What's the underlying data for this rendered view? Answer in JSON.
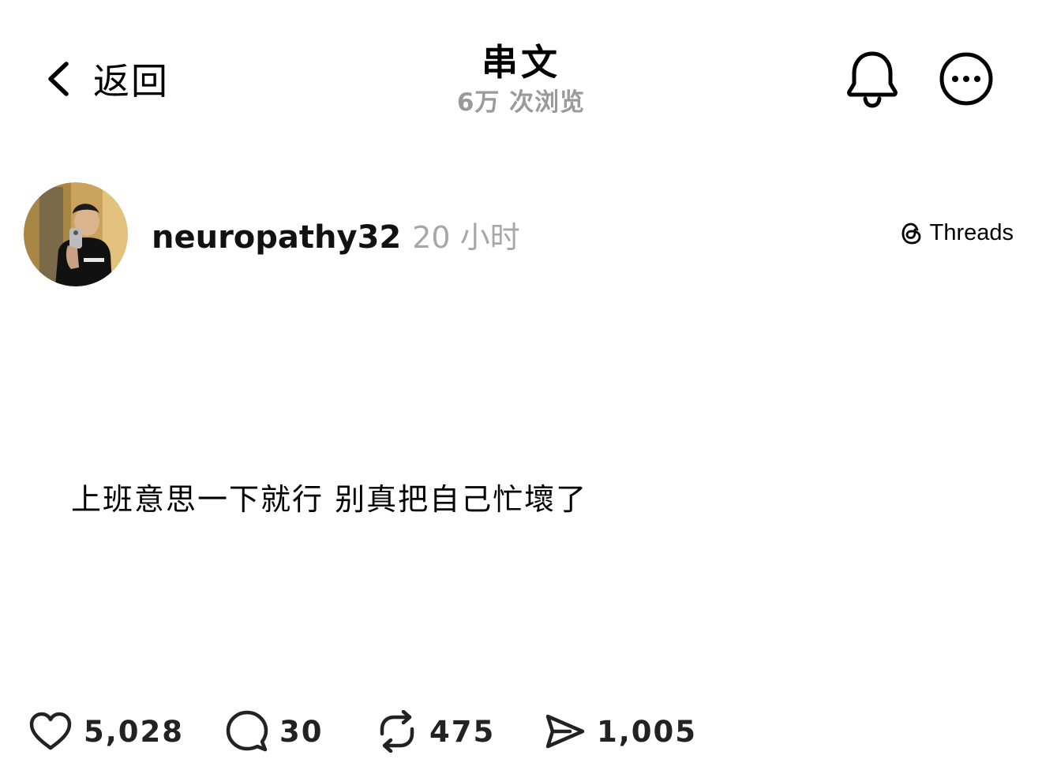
{
  "header": {
    "back_label": "返回",
    "title": "串文",
    "views": "6万 次浏览",
    "icons": {
      "back": "chevron-left-icon",
      "notifications": "bell-icon",
      "more": "more-options-icon"
    }
  },
  "post": {
    "author": {
      "username": "neuropathy32",
      "time": "20 小时",
      "avatar": "avatar-photo"
    },
    "badge": {
      "label": "Threads",
      "icon": "threads-logo-icon"
    },
    "text": "上班意思一下就行 别真把自己忙壞了",
    "stats": {
      "likes": "5,028",
      "comments": "30",
      "reposts": "475",
      "shares": "1,005"
    },
    "action_icons": [
      "heart-icon",
      "comment-icon",
      "repost-icon",
      "share-icon"
    ]
  }
}
